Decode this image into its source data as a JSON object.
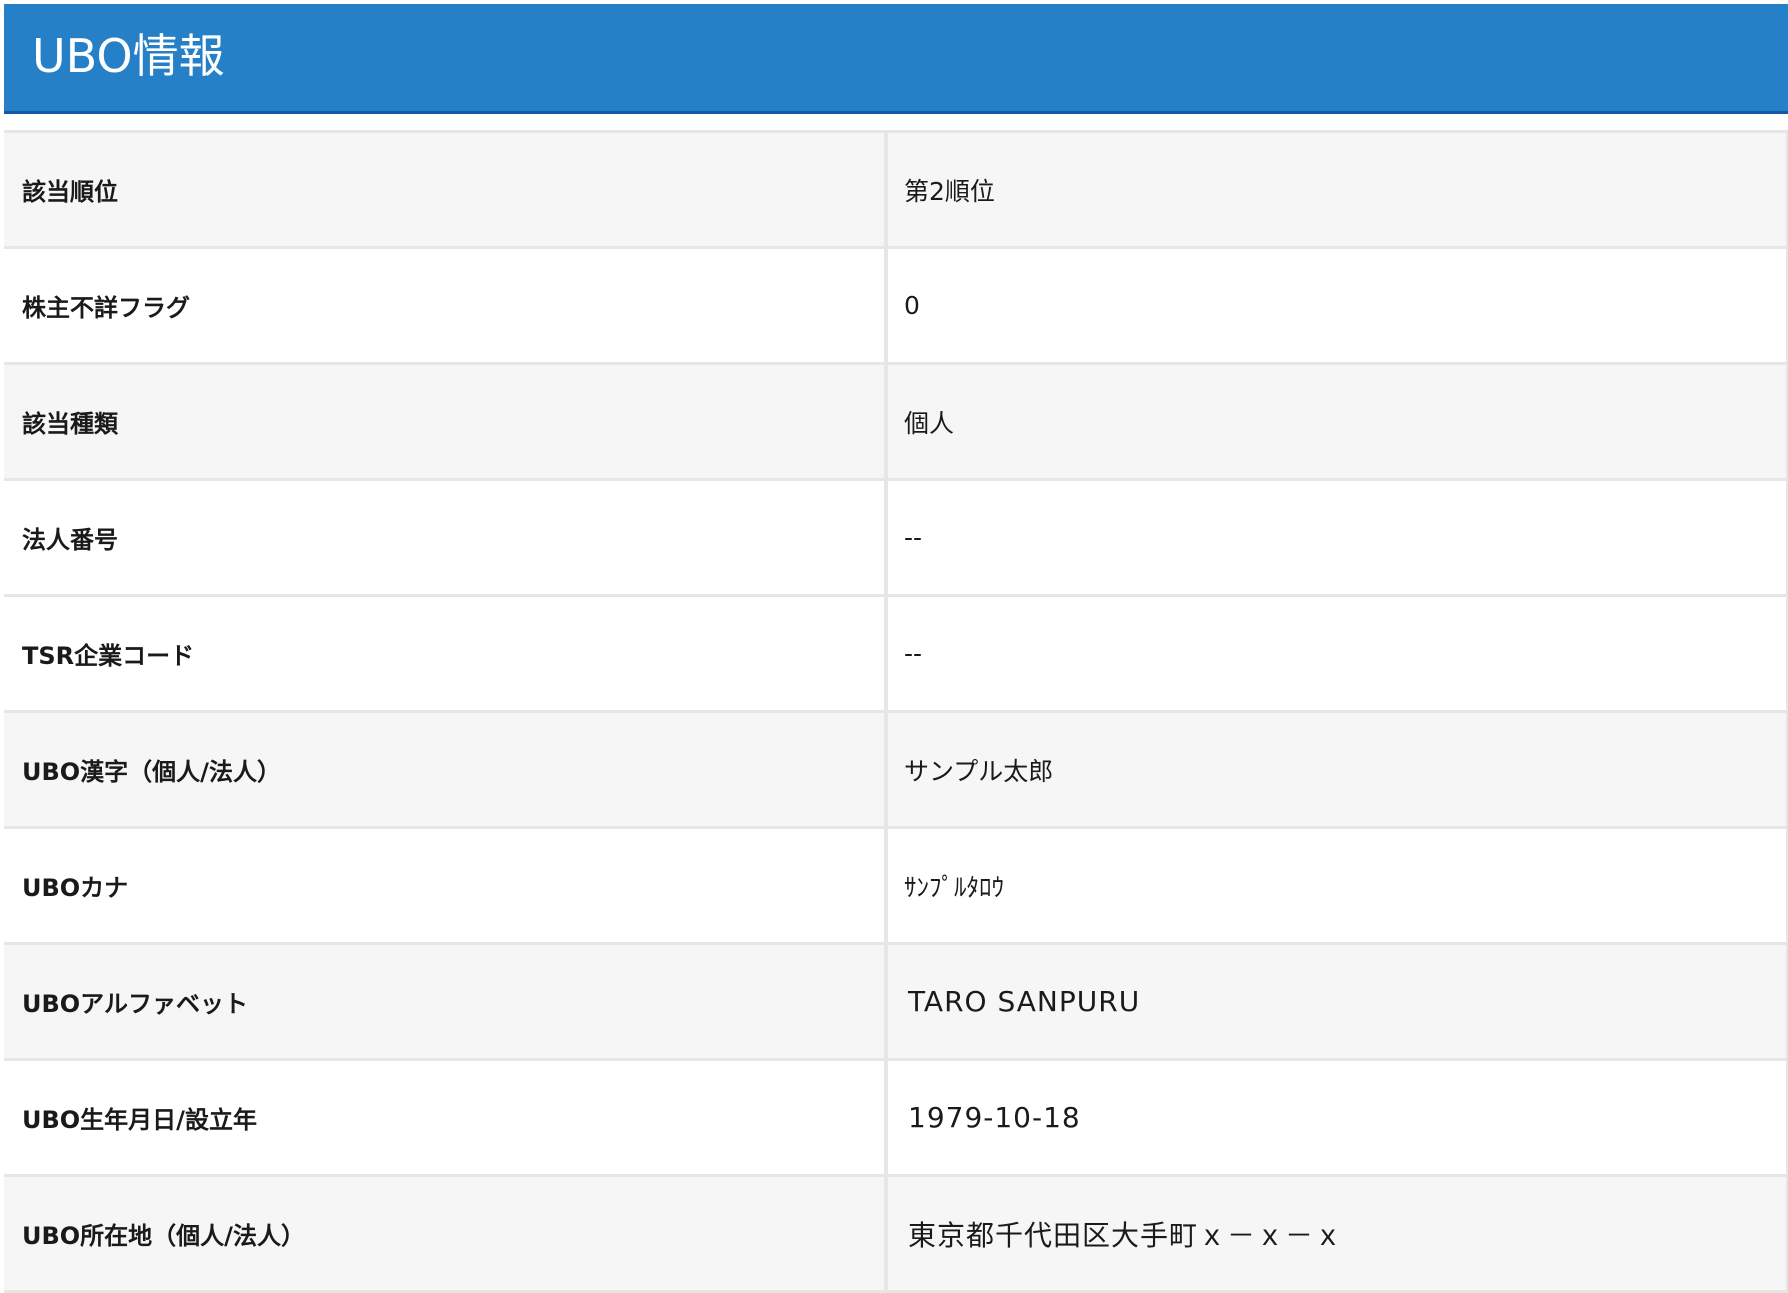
{
  "header": {
    "title": "UBO情報"
  },
  "rows": [
    {
      "label": "該当順位",
      "value": "第2順位"
    },
    {
      "label": "株主不詳フラグ",
      "value": "0"
    },
    {
      "label": "該当種類",
      "value": "個人"
    },
    {
      "label": "法人番号",
      "value": "--"
    },
    {
      "label": "TSR企業コード",
      "value": "--"
    },
    {
      "label": "UBO漢字（個人/法人）",
      "value": "サンプル太郎"
    },
    {
      "label": "UBOカナ",
      "value": "ｻﾝﾌﾟﾙﾀﾛｳ"
    },
    {
      "label": "UBOアルファベット",
      "value": "TARO SANPURU"
    },
    {
      "label": "UBO生年月日/設立年",
      "value": "1979-10-18"
    },
    {
      "label": "UBO所在地（個人/法人）",
      "value": "東京都千代田区大手町ｘ－ｘ－ｘ"
    }
  ],
  "colors": {
    "header_bg": "#2680c8",
    "header_border": "#1259a8",
    "row_shade": "#f6f6f6",
    "row_plain": "#ffffff",
    "grid": "#e6e6e6"
  }
}
